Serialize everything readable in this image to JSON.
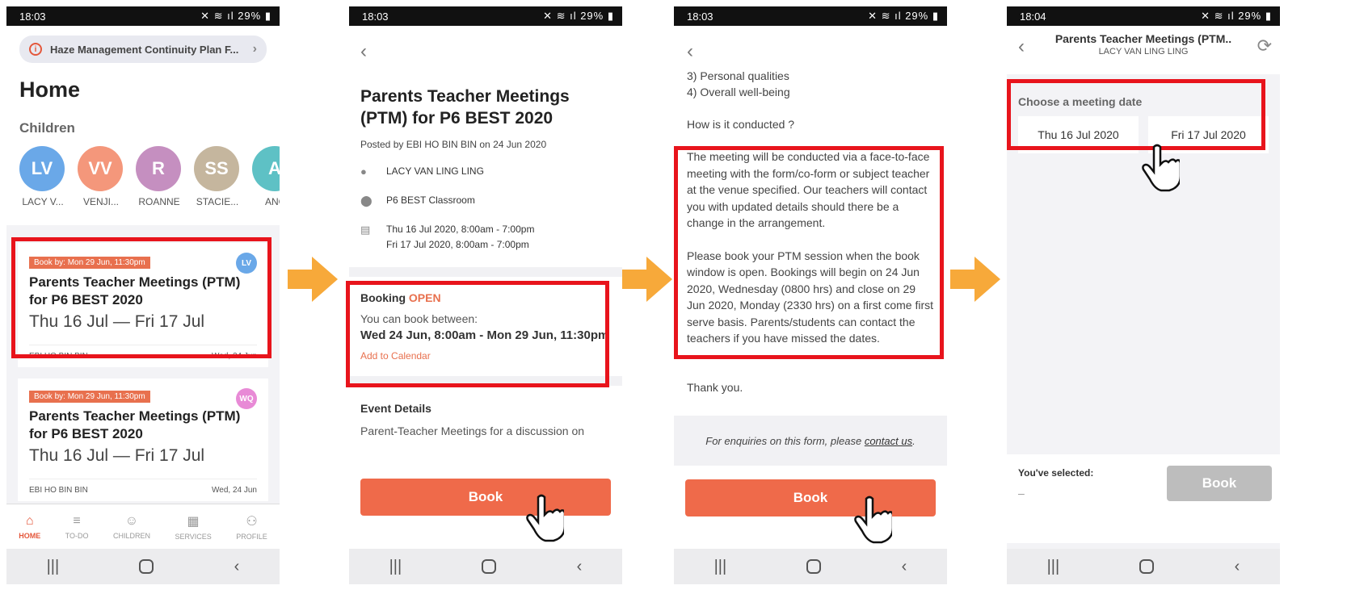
{
  "colors": {
    "accent": "#ef6a4a",
    "highlight": "#e8141c",
    "arrow": "#f7a93a"
  },
  "screen1": {
    "status": {
      "time": "18:03",
      "battery": "29%"
    },
    "alert": "Haze Management Continuity Plan F...",
    "title": "Home",
    "children_label": "Children",
    "children": [
      {
        "initials": "LV",
        "name": "LACY V...",
        "color": "#6aa8e8"
      },
      {
        "initials": "VV",
        "name": "VENJI...",
        "color": "#f4977b"
      },
      {
        "initials": "R",
        "name": "ROANNE",
        "color": "#c58fc0"
      },
      {
        "initials": "SS",
        "name": "STACIE...",
        "color": "#c5b69e"
      },
      {
        "initials": "A",
        "name": "ANG",
        "color": "#5ec1c5"
      }
    ],
    "cards": [
      {
        "tag": "Book by: Mon 29 Jun, 11:30pm",
        "badge": "LV",
        "badge_color": "#6aa8e8",
        "title": "Parents Teacher Meetings (PTM) for P6 BEST 2020",
        "dates": "Thu 16 Jul — Fri 17 Jul",
        "author": "EBI HO BIN BIN",
        "posted": "Wed, 24 Jun"
      },
      {
        "tag": "Book by: Mon 29 Jun, 11:30pm",
        "badge": "WQ",
        "badge_color": "#e88ad6",
        "title": "Parents Teacher Meetings (PTM) for P6 BEST 2020",
        "dates": "Thu 16 Jul — Fri 17 Jul",
        "author": "EBI HO BIN BIN",
        "posted": "Wed, 24 Jun"
      }
    ],
    "tabs": [
      {
        "icon": "⌂",
        "label": "HOME"
      },
      {
        "icon": "≡",
        "label": "TO-DO"
      },
      {
        "icon": "☺",
        "label": "CHILDREN"
      },
      {
        "icon": "▦",
        "label": "SERVICES"
      },
      {
        "icon": "⚇",
        "label": "PROFILE"
      }
    ]
  },
  "screen2": {
    "status": {
      "time": "18:03",
      "battery": "29%"
    },
    "title": "Parents Teacher Meetings (PTM) for P6 BEST 2020",
    "posted": "Posted by EBI HO BIN BIN on 24 Jun 2020",
    "student": "LACY VAN LING LING",
    "venue": "P6 BEST Classroom",
    "date1": "Thu 16 Jul 2020, 8:00am - 7:00pm",
    "date2": "Fri 17 Jul 2020, 8:00am - 7:00pm",
    "booking_label": "Booking",
    "booking_status": "OPEN",
    "booking_sub": "You can book between:",
    "booking_range": "Wed 24 Jun, 8:00am - Mon 29 Jun, 11:30pm",
    "add_calendar": "Add to Calendar",
    "event_label": "Event Details",
    "event_text": "Parent-Teacher Meetings for a discussion on",
    "book": "Book"
  },
  "screen3": {
    "status": {
      "time": "18:03",
      "battery": "29%"
    },
    "l1": "3) Personal qualities",
    "l2": "4) Overall well-being",
    "q": "How is it  conducted ?",
    "p1": "The meeting will be conducted via a face-to-face meeting with the form/co-form or subject teacher at the venue specified. Our teachers will contact you with updated details should there be a change in the arrangement.",
    "p2": "Please book your PTM session when the book window is open. Bookings will begin on 24 Jun 2020, Wednesday (0800 hrs) and close on 29 Jun 2020, Monday (2330 hrs) on a first come first serve basis. Parents/students can contact the  teachers if you have missed the dates.",
    "thanks": "Thank you.",
    "enquiry": "For enquiries on this form, please",
    "contact": "contact us",
    "book": "Book"
  },
  "screen4": {
    "status": {
      "time": "18:04",
      "battery": "29%"
    },
    "title": "Parents Teacher Meetings (PTM..",
    "subtitle": "LACY VAN LING LING",
    "choose": "Choose a meeting date",
    "date1": "Thu 16 Jul 2020",
    "date2": "Fri 17 Jul 2020",
    "selected_label": "You've selected:",
    "selected_value": "–",
    "book": "Book"
  }
}
